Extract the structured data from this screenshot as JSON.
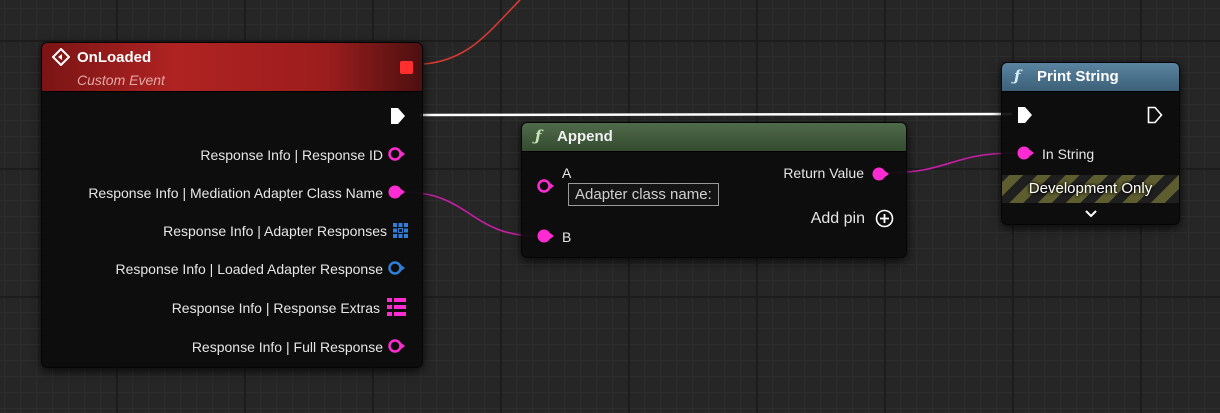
{
  "nodes": {
    "onloaded": {
      "title": "OnLoaded",
      "subtitle": "Custom Event",
      "header_color": "#8f1a1a",
      "icon": "event-diamond-icon",
      "pins": [
        {
          "label": "Response Info | Response ID",
          "icon": "object-pin-icon",
          "color": "#ff2bd2"
        },
        {
          "label": "Response Info | Mediation Adapter Class Name",
          "icon": "string-pin-icon",
          "color": "#ff2bd2"
        },
        {
          "label": "Response Info | Adapter Responses",
          "icon": "array-grid-icon",
          "color": "#2f7fd8"
        },
        {
          "label": "Response Info | Loaded Adapter Response",
          "icon": "object-pin-icon",
          "color": "#2f7fd8"
        },
        {
          "label": "Response Info | Response Extras",
          "icon": "map-list-icon",
          "color": "#ff2bd2"
        },
        {
          "label": "Response Info | Full Response",
          "icon": "object-pin-icon",
          "color": "#ff2bd2"
        }
      ]
    },
    "append": {
      "title": "Append",
      "header_color": "#3e5a3a",
      "icon": "function-icon",
      "pin_a": "A",
      "pin_a_value": "Adapter class name:",
      "pin_b": "B",
      "return_value": "Return Value",
      "add_pin": "Add pin"
    },
    "print_string": {
      "title": "Print String",
      "header_color": "#456f8a",
      "icon": "function-icon",
      "in_string": "In String",
      "development_only": "Development Only",
      "expand_icon": "chevron-down-icon"
    }
  },
  "colors": {
    "exec_wire": "#ffffff",
    "string_wire": "#c81ea8",
    "delegate_wire": "#d43a30",
    "string_pin": "#ff2bd2",
    "struct_pin": "#2f7fd8"
  }
}
